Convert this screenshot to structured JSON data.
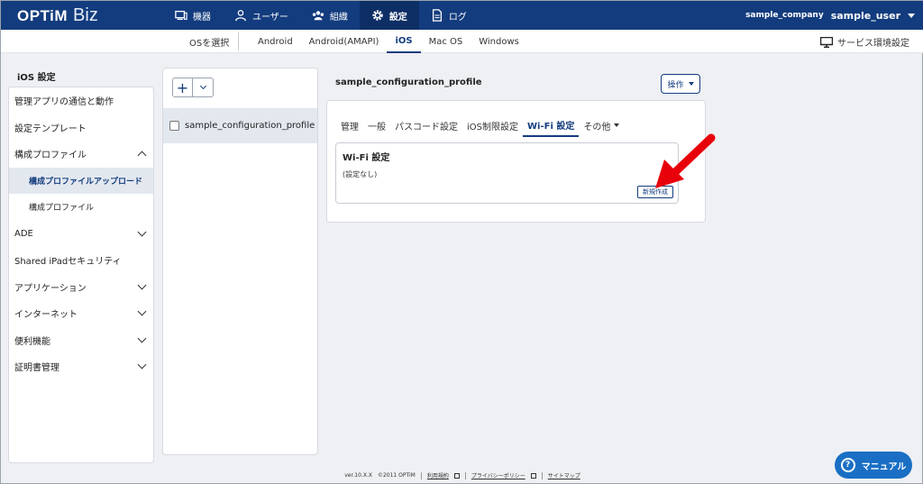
{
  "header": {
    "logo_text": "OPTiM",
    "logo_suffix": "Biz",
    "nav": [
      {
        "label": "機器",
        "icon": "device-icon"
      },
      {
        "label": "ユーザー",
        "icon": "user-icon"
      },
      {
        "label": "組織",
        "icon": "organization-icon"
      },
      {
        "label": "設定",
        "icon": "gear-icon",
        "active": true
      },
      {
        "label": "ログ",
        "icon": "document-icon"
      }
    ],
    "company": "sample_company",
    "user": "sample_user"
  },
  "os_bar": {
    "select_label": "OSを選択",
    "tabs": [
      "Android",
      "Android(AMAPI)",
      "iOS",
      "Mac OS",
      "Windows"
    ],
    "active_tab": "iOS",
    "service_env": "サービス環境設定"
  },
  "sidebar": {
    "title": "iOS 設定",
    "items": [
      {
        "label": "管理アプリの通信と動作"
      },
      {
        "label": "設定テンプレート"
      },
      {
        "label": "構成プロファイル",
        "expanded": true
      },
      {
        "label": "構成プロファイルアップロード",
        "sub": true,
        "selected": true
      },
      {
        "label": "構成プロファイル",
        "sub": true
      },
      {
        "label": "ADE"
      },
      {
        "label": "Shared iPadセキュリティ"
      },
      {
        "label": "アプリケーション"
      },
      {
        "label": "インターネット"
      },
      {
        "label": "便利機能"
      },
      {
        "label": "証明書管理"
      }
    ]
  },
  "list": {
    "add_label": "+",
    "profile_name": "sample_configuration_profile"
  },
  "main": {
    "title": "sample_configuration_profile",
    "ops_label": "操作",
    "subtabs": [
      "管理",
      "一般",
      "パスコード設定",
      "iOS制限設定",
      "Wi-Fi 設定",
      "その他"
    ],
    "active_subtab": "Wi-Fi 設定",
    "wifi_title": "Wi-Fi 設定",
    "wifi_empty": "(設定なし)",
    "new_label": "新規作成"
  },
  "footer": {
    "version": "ver.10.X.X",
    "copyright": "©2011 OPTiM",
    "terms": "利用規約",
    "privacy": "プライバシーポリシー",
    "sitemap": "サイトマップ"
  },
  "manual_label": "マニュアル",
  "colors": {
    "brand": "#133c7e",
    "accent": "#1a6fc4",
    "arrow": "#e8000b"
  }
}
